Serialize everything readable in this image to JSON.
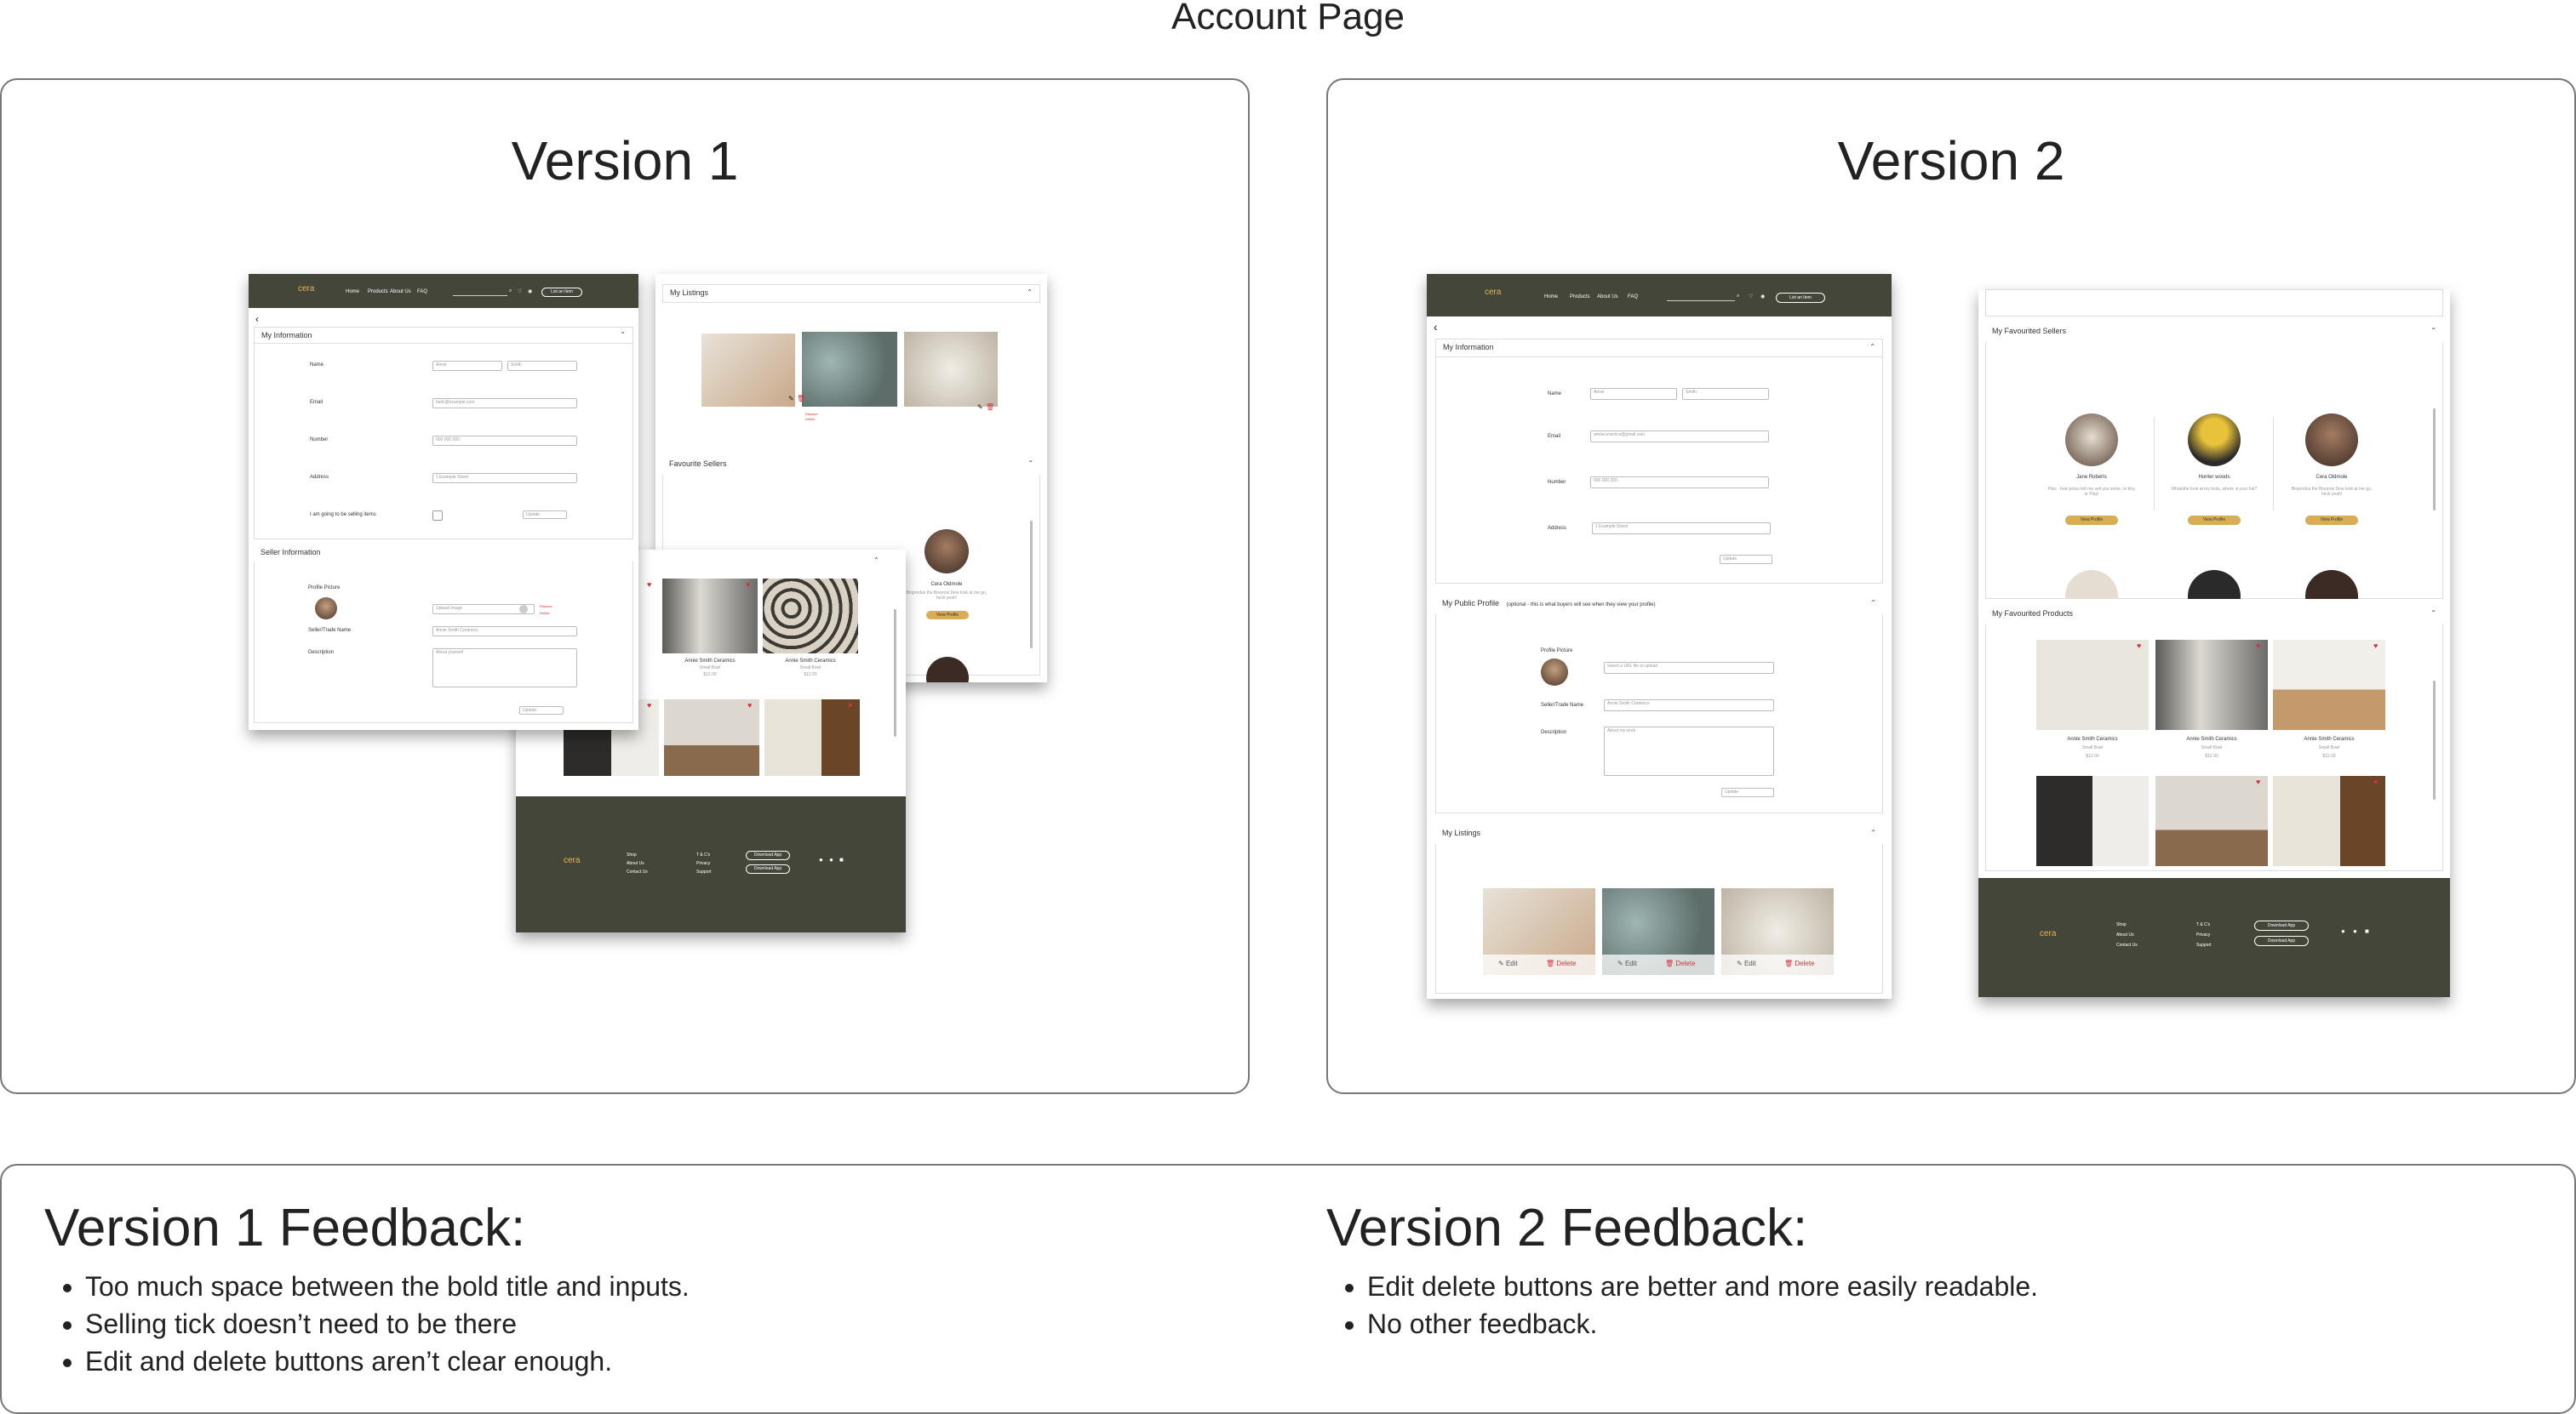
{
  "page_title": "Account Page",
  "v1": {
    "title": "Version 1",
    "nav": {
      "logo": "cera",
      "links": [
        "Home",
        "Products",
        "About Us",
        "FAQ"
      ],
      "sell": "List an Item"
    },
    "my_info": {
      "heading": "My Information",
      "fields": [
        {
          "label": "Name",
          "value": "Annie",
          "value2": "Smith"
        },
        {
          "label": "Email",
          "value": "hello@example.com"
        },
        {
          "label": "Number",
          "value": "000 000 000"
        },
        {
          "label": "Address",
          "value": "1 Example Street"
        },
        {
          "label": "I am going to be selling items"
        }
      ],
      "update": "Update"
    },
    "seller_info": {
      "heading": "Seller Information",
      "labels": [
        "Profile Picture",
        "Seller/Trade Name",
        "Description"
      ],
      "upload": "Upload Image",
      "edit": "Replace",
      "delete": "Delete",
      "trade_value": "Annie Smith Ceramics",
      "desc_value": "About yourself",
      "update": "Update"
    },
    "listings": {
      "heading": "My Listings",
      "replace": "Replace",
      "delete": "Delete"
    },
    "fav_sellers": {
      "heading": "Favourite Sellers",
      "name": "Cera Oldmole",
      "desc": "Bioprodus the Bioorow Dew look at me go, heck yeah!",
      "btn": "View Profile"
    },
    "fav_products": {
      "cards": [
        {
          "name": "Annie Smith Ceramics",
          "type": "Small Bowl",
          "price": "$12.00"
        },
        {
          "name": "Annie Smith Ceramics",
          "type": "Small Bowl",
          "price": "$12.00"
        }
      ]
    },
    "footer": {
      "logo": "cera",
      "col1": [
        "Shop",
        "About Us",
        "Contact Us"
      ],
      "col2": [
        "T & C's",
        "Privacy",
        "Support"
      ],
      "apps": [
        "Download App",
        "Download App"
      ]
    }
  },
  "v2": {
    "title": "Version 2",
    "nav": {
      "logo": "cera",
      "links": [
        "Home",
        "Products",
        "About Us",
        "FAQ"
      ],
      "sell": "List an Item"
    },
    "my_info": {
      "heading": "My Information",
      "fields": [
        {
          "label": "Name",
          "value": "Annie",
          "value2": "Smith"
        },
        {
          "label": "Email",
          "value": "annieceramics@gmail.com"
        },
        {
          "label": "Number",
          "value": "000 000 000"
        },
        {
          "label": "Address",
          "value": "1 Example Street"
        }
      ],
      "update": "Update"
    },
    "public_profile": {
      "heading": "My Public Profile",
      "subheading": "(optional - this is what buyers will see when they view your profile)",
      "labels": [
        "Profile Picture",
        "Seller/Trade Name",
        "Description"
      ],
      "upload": "Select a URL file to upload",
      "trade_value": "Annie Smith Ceramics",
      "desc_value": "About my work",
      "update": "Update"
    },
    "listings": {
      "heading": "My Listings",
      "edit": "Edit",
      "delete": "Delete"
    },
    "fav_sellers": {
      "heading": "My Favourited Sellers",
      "sellers": [
        {
          "name": "Jane Roberts",
          "desc": "Plan - how potus lett me sell you some, or tiny, or Play!"
        },
        {
          "name": "Hunter woods",
          "desc": "Whatsthe look at my tools, where is your hat?"
        },
        {
          "name": "Cera Oldmole",
          "desc": "Bioprodus the Bioorow Dew look at me go, heck yeah!"
        }
      ],
      "btn": "View Profile"
    },
    "fav_products": {
      "heading": "My Favourited Products",
      "cards": [
        {
          "name": "Annie Smith Ceramics",
          "type": "Small Bowl",
          "price": "$12.00"
        },
        {
          "name": "Annie Smith Ceramics",
          "type": "Small Bowl",
          "price": "$12.00"
        },
        {
          "name": "Annie Smith Ceramics",
          "type": "Small Bowl",
          "price": "$12.00"
        }
      ]
    },
    "footer": {
      "logo": "cera",
      "col1": [
        "Shop",
        "About Us",
        "Contact Us"
      ],
      "col2": [
        "T & C's",
        "Privacy",
        "Support"
      ],
      "apps": [
        "Download App",
        "Download App"
      ]
    }
  },
  "feedback": {
    "v1": {
      "title": "Version 1 Feedback:",
      "items": [
        "Too much space between the bold title and inputs.",
        "Selling tick doesn’t need to be there",
        "Edit and delete buttons aren’t clear enough."
      ]
    },
    "v2": {
      "title": "Version 2 Feedback:",
      "items": [
        "Edit delete buttons are better and more easily readable.",
        "No other feedback."
      ]
    }
  },
  "colors": {
    "nav_dark": "#45463a",
    "accent_gold": "#d8ad55",
    "heart_red": "#d0343c"
  }
}
